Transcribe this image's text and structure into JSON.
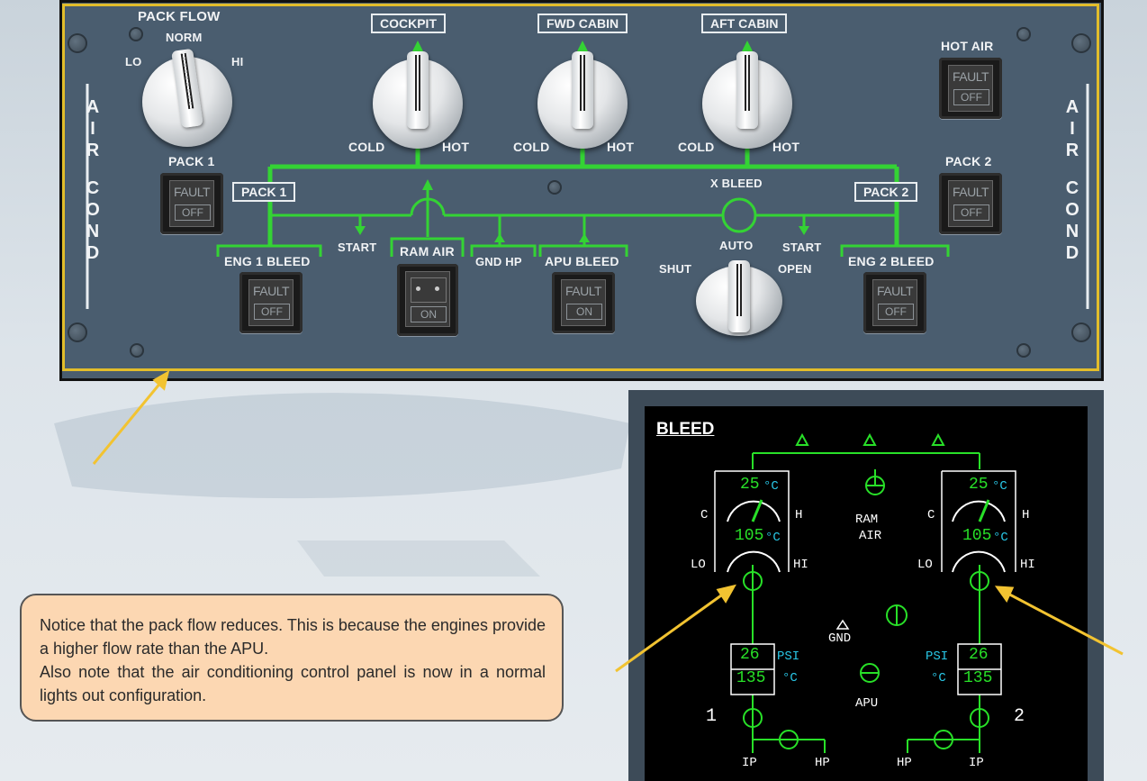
{
  "panel": {
    "pack_flow": {
      "title": "PACK FLOW",
      "norm": "NORM",
      "lo": "LO",
      "hi": "HI"
    },
    "zones": [
      {
        "label": "COCKPIT",
        "cold": "COLD",
        "hot": "HOT"
      },
      {
        "label": "FWD CABIN",
        "cold": "COLD",
        "hot": "HOT"
      },
      {
        "label": "AFT CABIN",
        "cold": "COLD",
        "hot": "HOT"
      }
    ],
    "hot_air": {
      "label": "HOT AIR",
      "top": "FAULT",
      "bottom": "OFF"
    },
    "side_label": [
      "A",
      "I",
      "R",
      "C",
      "O",
      "N",
      "D"
    ],
    "pack1": {
      "label": "PACK 1",
      "box": "PACK 1",
      "top": "FAULT",
      "bottom": "OFF"
    },
    "pack2": {
      "label": "PACK 2",
      "box": "PACK 2",
      "top": "FAULT",
      "bottom": "OFF"
    },
    "x_bleed": {
      "title": "X BLEED",
      "auto": "AUTO",
      "shut": "SHUT",
      "open": "OPEN"
    },
    "start_left": "START",
    "start_right": "START",
    "ram_air": {
      "label": "RAM AIR",
      "bottom": "ON"
    },
    "gnd_hp": "GND HP",
    "eng1_bleed": {
      "label": "ENG 1 BLEED",
      "top": "FAULT",
      "bottom": "OFF"
    },
    "apu_bleed": {
      "label": "APU BLEED",
      "top": "FAULT",
      "bottom": "ON"
    },
    "eng2_bleed": {
      "label": "ENG 2 BLEED",
      "top": "FAULT",
      "bottom": "OFF"
    }
  },
  "ecam": {
    "title": "BLEED",
    "left": {
      "temp_top": "25",
      "temp_mid": "105",
      "unit": "°C",
      "c": "C",
      "h": "H",
      "lo": "LO",
      "hi": "HI",
      "psi_val": "26",
      "temp_low": "135",
      "psi": "PSI",
      "deg": "°C",
      "engine": "1",
      "ip": "IP",
      "hp": "HP"
    },
    "right": {
      "temp_top": "25",
      "temp_mid": "105",
      "unit": "°C",
      "c": "C",
      "h": "H",
      "lo": "LO",
      "hi": "HI",
      "psi_val": "26",
      "temp_low": "135",
      "psi": "PSI",
      "deg": "°C",
      "engine": "2",
      "ip": "IP",
      "hp": "HP"
    },
    "ram_air": [
      "RAM",
      "AIR"
    ],
    "gnd": "GND",
    "apu": "APU",
    "colors": {
      "green": "#28e028",
      "cyan": "#29c7e6",
      "white": "#ffffff"
    }
  },
  "note": {
    "lines": [
      "Notice that the pack flow reduces. This is because the engines provide a higher flow rate than the APU.",
      "Also note that the air conditioning control panel is now in a normal lights out configuration."
    ]
  },
  "colors": {
    "panel": "#4a5d6f",
    "highlight": "#e2bd2b",
    "duct": "#34d334",
    "note_bg": "#fcd7b2"
  }
}
